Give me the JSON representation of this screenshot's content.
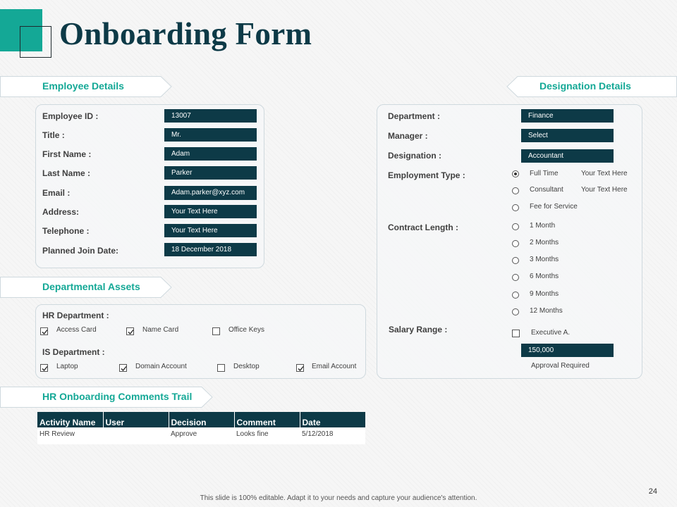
{
  "title": "Onboarding Form",
  "colors": {
    "accent": "#14a896",
    "dark": "#0d3a47"
  },
  "employee_details": {
    "header": "Employee Details",
    "fields": [
      {
        "label": "Employee ID :",
        "value": "13007"
      },
      {
        "label": "Title :",
        "value": "Mr."
      },
      {
        "label": "First Name :",
        "value": "Adam"
      },
      {
        "label": "Last Name :",
        "value": "Parker"
      },
      {
        "label": "Email :",
        "value": "Adam.parker@xyz.com"
      },
      {
        "label": "Address:",
        "value": "Your Text Here"
      },
      {
        "label": "Telephone :",
        "value": "Your Text Here"
      },
      {
        "label": "Planned Join Date:",
        "value": "18 December 2018"
      }
    ]
  },
  "designation_details": {
    "header": "Designation Details",
    "department_label": "Department :",
    "department_value": "Finance",
    "manager_label": "Manager :",
    "manager_value": "Select",
    "designation_label": "Designation :",
    "designation_value": "Accountant",
    "employment_type_label": "Employment Type :",
    "employment_types": [
      {
        "label": "Full Time",
        "note": "Your Text Here",
        "selected": true
      },
      {
        "label": "Consultant",
        "note": "Your Text Here",
        "selected": false
      },
      {
        "label": "Fee for Service",
        "note": "",
        "selected": false
      }
    ],
    "contract_length_label": "Contract Length :",
    "contract_lengths": [
      "1 Month",
      "2 Months",
      "3 Months",
      "6 Months",
      "9 Months",
      "12 Months"
    ],
    "salary_range_label": "Salary Range :",
    "salary_option": "Executive A.",
    "salary_value": "150,000",
    "approval_note": "Approval Required"
  },
  "departmental_assets": {
    "header": "Departmental Assets",
    "hr_label": "HR Department :",
    "hr_items": [
      {
        "label": "Access Card",
        "checked": true
      },
      {
        "label": "Name Card",
        "checked": true
      },
      {
        "label": "Office Keys",
        "checked": false
      }
    ],
    "is_label": "IS Department :",
    "is_items": [
      {
        "label": "Laptop",
        "checked": true
      },
      {
        "label": "Domain  Account",
        "checked": true
      },
      {
        "label": "Desktop",
        "checked": false
      },
      {
        "label": "Email  Account",
        "checked": true
      }
    ]
  },
  "comments_trail": {
    "header": "HR Onboarding Comments Trail",
    "columns": [
      "Activity  Name",
      "User",
      "Decision",
      "Comment",
      "Date"
    ],
    "rows": [
      [
        "HR Review",
        "",
        "Approve",
        "Looks fine",
        "5/12/2018"
      ]
    ]
  },
  "footer": "This slide is 100% editable. Adapt it to your needs and capture your audience's attention.",
  "page_number": "24"
}
